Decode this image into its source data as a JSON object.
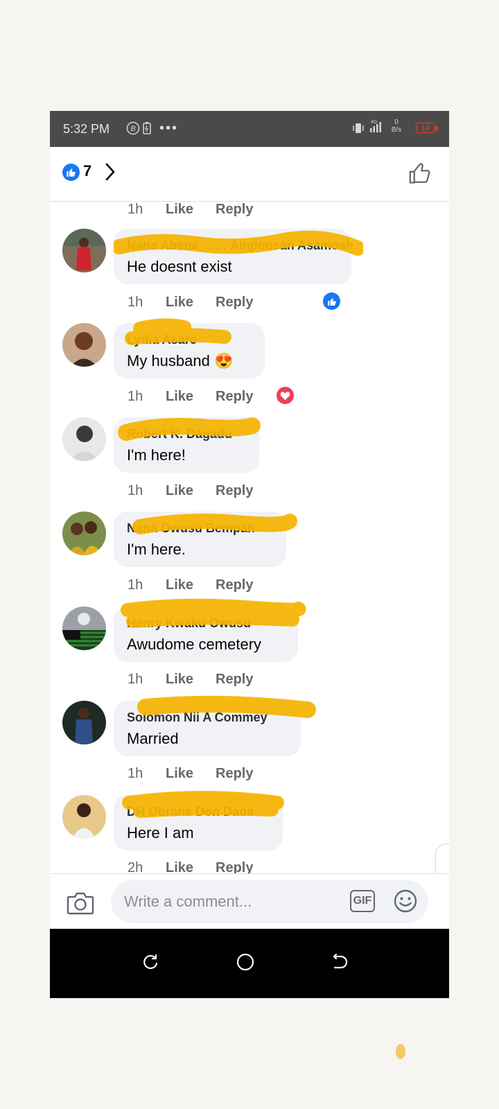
{
  "status_bar": {
    "time": "5:32 PM",
    "network": "4G",
    "speed_value": "0",
    "speed_unit": "B/s",
    "battery": "14"
  },
  "header": {
    "reaction_count": "7",
    "like_icon": "thumbs-up-icon"
  },
  "actions": {
    "like": "Like",
    "reply": "Reply"
  },
  "first_meta": {
    "time": "1h"
  },
  "comments": [
    {
      "name": "Nana Abena …… Amponsah Asamoah",
      "text": "He doesnt exist",
      "time": "1h",
      "reaction_count": "1",
      "reaction": "like"
    },
    {
      "name": "Lydia Asare",
      "text": "My husband 😍",
      "time": "1h",
      "reaction_count": "1",
      "reaction": "love"
    },
    {
      "name": "Robert K. Dagadu",
      "text": "I'm here!",
      "time": "1h"
    },
    {
      "name": "Nana Owusu Bempah",
      "text": "I'm here.",
      "time": "1h"
    },
    {
      "name": "Henry Kwaku Owusu",
      "text": "Awudome cemetery",
      "time": "1h"
    },
    {
      "name": "Solomon Nii A Commey",
      "text": "Married",
      "time": "1h"
    },
    {
      "name": "DH Obrane Don Dada",
      "text": "Here I am",
      "time": "2h"
    }
  ],
  "composer": {
    "placeholder": "Write a comment...",
    "gif_label": "GIF"
  },
  "colors": {
    "brand_blue": "#1877f2",
    "love_red": "#f33e58",
    "redaction_yellow": "#f5b400"
  }
}
